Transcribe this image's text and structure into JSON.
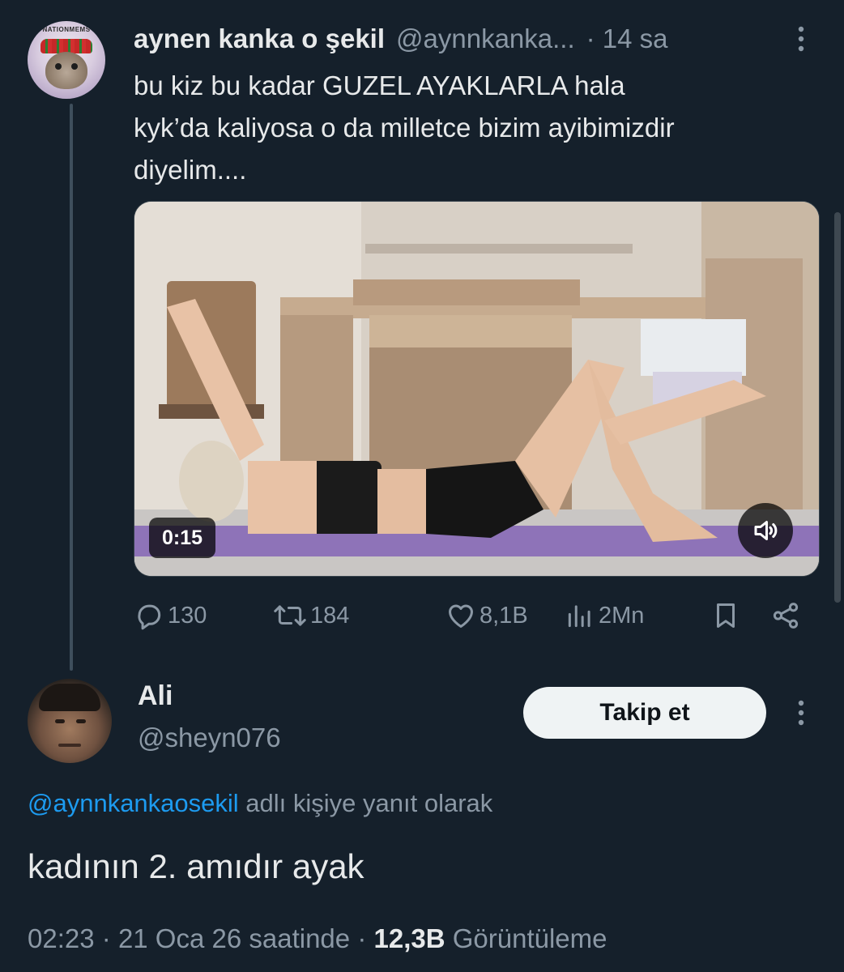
{
  "parent_tweet": {
    "avatar_text": "NATIONMEMS",
    "display_name": "aynen kanka o şekil",
    "handle": "@aynnkanka...",
    "time": "· 14 sa",
    "text_lines": [
      "bu kiz bu kadar GUZEL AYAKLARLA hala",
      "kyk’da kaliyosa o da milletce bizim ayibimizdir",
      "diyelim...."
    ],
    "video": {
      "duration": "0:15",
      "muted": true
    },
    "stats": {
      "replies": "130",
      "reposts": "184",
      "likes": "8,1B",
      "views": "2Mn"
    },
    "icons": {
      "reply": "reply-icon",
      "repost": "repost-icon",
      "like": "heart-icon",
      "views": "views-icon",
      "bookmark": "bookmark-icon",
      "share": "share-icon",
      "more": "more-vertical-icon",
      "volume": "volume-icon"
    }
  },
  "reply": {
    "display_name": "Ali",
    "handle": "@sheyn076",
    "follow_label": "Takip et",
    "replying_to_handle": "@aynnkankaosekil",
    "replying_to_suffix": " adlı kişiye yanıt olarak",
    "text": "kadının 2. amıdır ayak",
    "meta": {
      "time": "02:23",
      "date": "21 Oca 26 saatinde",
      "views_count": "12,3B",
      "views_label": "Görüntüleme"
    }
  },
  "colors": {
    "background": "#15202b",
    "text_primary": "#e7e9ea",
    "text_secondary": "#8b98a5",
    "accent": "#1d9bf0",
    "follow_button_bg": "#eff3f4"
  }
}
